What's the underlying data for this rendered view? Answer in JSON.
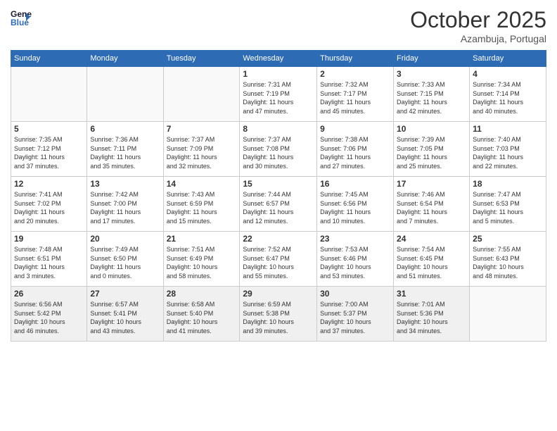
{
  "header": {
    "logo_line1": "General",
    "logo_line2": "Blue",
    "month": "October 2025",
    "location": "Azambuja, Portugal"
  },
  "days_of_week": [
    "Sunday",
    "Monday",
    "Tuesday",
    "Wednesday",
    "Thursday",
    "Friday",
    "Saturday"
  ],
  "weeks": [
    [
      {
        "day": "",
        "info": ""
      },
      {
        "day": "",
        "info": ""
      },
      {
        "day": "",
        "info": ""
      },
      {
        "day": "1",
        "info": "Sunrise: 7:31 AM\nSunset: 7:19 PM\nDaylight: 11 hours\nand 47 minutes."
      },
      {
        "day": "2",
        "info": "Sunrise: 7:32 AM\nSunset: 7:17 PM\nDaylight: 11 hours\nand 45 minutes."
      },
      {
        "day": "3",
        "info": "Sunrise: 7:33 AM\nSunset: 7:15 PM\nDaylight: 11 hours\nand 42 minutes."
      },
      {
        "day": "4",
        "info": "Sunrise: 7:34 AM\nSunset: 7:14 PM\nDaylight: 11 hours\nand 40 minutes."
      }
    ],
    [
      {
        "day": "5",
        "info": "Sunrise: 7:35 AM\nSunset: 7:12 PM\nDaylight: 11 hours\nand 37 minutes."
      },
      {
        "day": "6",
        "info": "Sunrise: 7:36 AM\nSunset: 7:11 PM\nDaylight: 11 hours\nand 35 minutes."
      },
      {
        "day": "7",
        "info": "Sunrise: 7:37 AM\nSunset: 7:09 PM\nDaylight: 11 hours\nand 32 minutes."
      },
      {
        "day": "8",
        "info": "Sunrise: 7:37 AM\nSunset: 7:08 PM\nDaylight: 11 hours\nand 30 minutes."
      },
      {
        "day": "9",
        "info": "Sunrise: 7:38 AM\nSunset: 7:06 PM\nDaylight: 11 hours\nand 27 minutes."
      },
      {
        "day": "10",
        "info": "Sunrise: 7:39 AM\nSunset: 7:05 PM\nDaylight: 11 hours\nand 25 minutes."
      },
      {
        "day": "11",
        "info": "Sunrise: 7:40 AM\nSunset: 7:03 PM\nDaylight: 11 hours\nand 22 minutes."
      }
    ],
    [
      {
        "day": "12",
        "info": "Sunrise: 7:41 AM\nSunset: 7:02 PM\nDaylight: 11 hours\nand 20 minutes."
      },
      {
        "day": "13",
        "info": "Sunrise: 7:42 AM\nSunset: 7:00 PM\nDaylight: 11 hours\nand 17 minutes."
      },
      {
        "day": "14",
        "info": "Sunrise: 7:43 AM\nSunset: 6:59 PM\nDaylight: 11 hours\nand 15 minutes."
      },
      {
        "day": "15",
        "info": "Sunrise: 7:44 AM\nSunset: 6:57 PM\nDaylight: 11 hours\nand 12 minutes."
      },
      {
        "day": "16",
        "info": "Sunrise: 7:45 AM\nSunset: 6:56 PM\nDaylight: 11 hours\nand 10 minutes."
      },
      {
        "day": "17",
        "info": "Sunrise: 7:46 AM\nSunset: 6:54 PM\nDaylight: 11 hours\nand 7 minutes."
      },
      {
        "day": "18",
        "info": "Sunrise: 7:47 AM\nSunset: 6:53 PM\nDaylight: 11 hours\nand 5 minutes."
      }
    ],
    [
      {
        "day": "19",
        "info": "Sunrise: 7:48 AM\nSunset: 6:51 PM\nDaylight: 11 hours\nand 3 minutes."
      },
      {
        "day": "20",
        "info": "Sunrise: 7:49 AM\nSunset: 6:50 PM\nDaylight: 11 hours\nand 0 minutes."
      },
      {
        "day": "21",
        "info": "Sunrise: 7:51 AM\nSunset: 6:49 PM\nDaylight: 10 hours\nand 58 minutes."
      },
      {
        "day": "22",
        "info": "Sunrise: 7:52 AM\nSunset: 6:47 PM\nDaylight: 10 hours\nand 55 minutes."
      },
      {
        "day": "23",
        "info": "Sunrise: 7:53 AM\nSunset: 6:46 PM\nDaylight: 10 hours\nand 53 minutes."
      },
      {
        "day": "24",
        "info": "Sunrise: 7:54 AM\nSunset: 6:45 PM\nDaylight: 10 hours\nand 51 minutes."
      },
      {
        "day": "25",
        "info": "Sunrise: 7:55 AM\nSunset: 6:43 PM\nDaylight: 10 hours\nand 48 minutes."
      }
    ],
    [
      {
        "day": "26",
        "info": "Sunrise: 6:56 AM\nSunset: 5:42 PM\nDaylight: 10 hours\nand 46 minutes."
      },
      {
        "day": "27",
        "info": "Sunrise: 6:57 AM\nSunset: 5:41 PM\nDaylight: 10 hours\nand 43 minutes."
      },
      {
        "day": "28",
        "info": "Sunrise: 6:58 AM\nSunset: 5:40 PM\nDaylight: 10 hours\nand 41 minutes."
      },
      {
        "day": "29",
        "info": "Sunrise: 6:59 AM\nSunset: 5:38 PM\nDaylight: 10 hours\nand 39 minutes."
      },
      {
        "day": "30",
        "info": "Sunrise: 7:00 AM\nSunset: 5:37 PM\nDaylight: 10 hours\nand 37 minutes."
      },
      {
        "day": "31",
        "info": "Sunrise: 7:01 AM\nSunset: 5:36 PM\nDaylight: 10 hours\nand 34 minutes."
      },
      {
        "day": "",
        "info": ""
      }
    ]
  ]
}
